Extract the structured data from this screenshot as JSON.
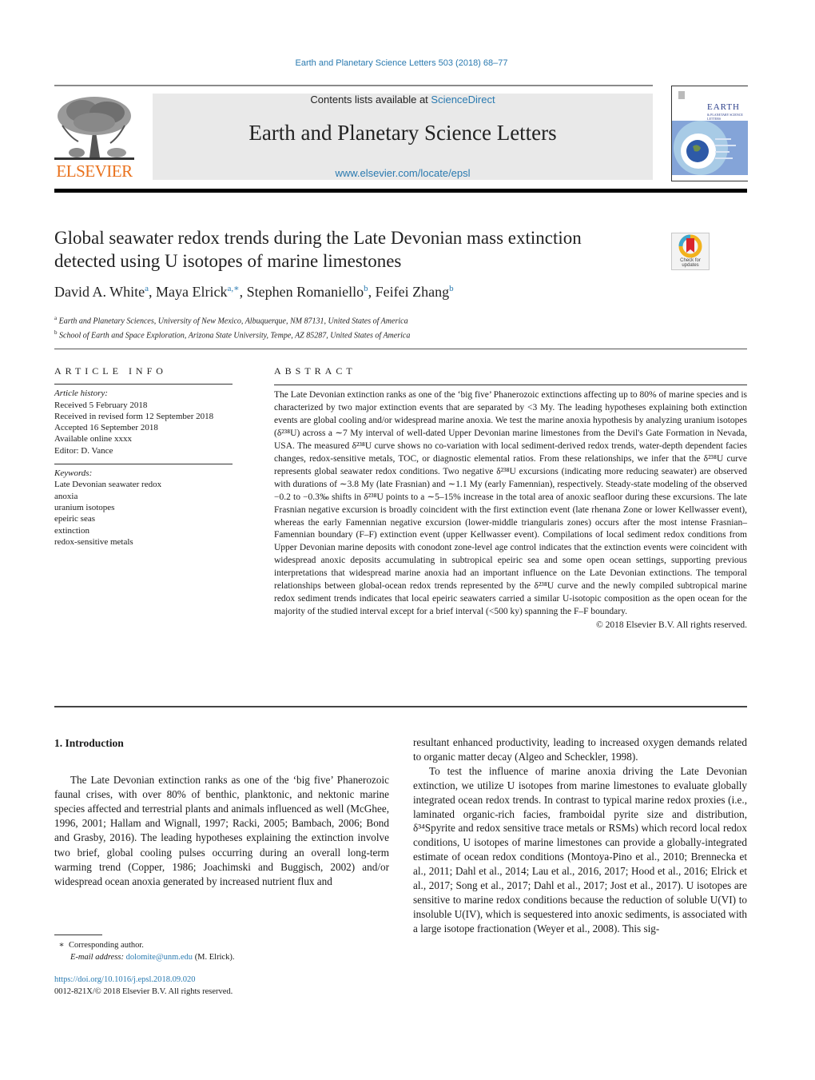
{
  "header": {
    "journal_reference": "Earth and Planetary Science Letters 503 (2018) 68–77",
    "contents_prefix": "Contents lists available at ",
    "contents_link": "ScienceDirect",
    "journal_title": "Earth and Planetary Science Letters",
    "journal_url": "www.elsevier.com/locate/epsl",
    "publisher_logo_text": "ELSEVIER",
    "cover_title": "EARTH",
    "cover_subtitle": "& PLANETARY SCIENCE LETTERS"
  },
  "article": {
    "title": "Global seawater redox trends during the Late Devonian mass extinction detected using U isotopes of marine limestones",
    "check_updates_label": "Check for updates",
    "authors": [
      {
        "name": "David A. White",
        "sup": "a"
      },
      {
        "name": "Maya Elrick",
        "sup": "a,∗"
      },
      {
        "name": "Stephen Romaniello",
        "sup": "b"
      },
      {
        "name": "Feifei Zhang",
        "sup": "b"
      }
    ],
    "affiliations": [
      {
        "sup": "a",
        "text": "Earth and Planetary Sciences, University of New Mexico, Albuquerque, NM 87131, United States of America"
      },
      {
        "sup": "b",
        "text": "School of Earth and Space Exploration, Arizona State University, Tempe, AZ 85287, United States of America"
      }
    ]
  },
  "article_info": {
    "heading": "ARTICLE INFO",
    "history_label": "Article history:",
    "history": [
      "Received 5 February 2018",
      "Received in revised form 12 September 2018",
      "Accepted 16 September 2018",
      "Available online xxxx",
      "Editor: D. Vance"
    ],
    "keywords_label": "Keywords:",
    "keywords": [
      "Late Devonian seawater redox",
      "anoxia",
      "uranium isotopes",
      "epeiric seas",
      "extinction",
      "redox-sensitive metals"
    ]
  },
  "abstract": {
    "heading": "ABSTRACT",
    "text": "The Late Devonian extinction ranks as one of the ‘big five’ Phanerozoic extinctions affecting up to 80% of marine species and is characterized by two major extinction events that are separated by <3 My. The leading hypotheses explaining both extinction events are global cooling and/or widespread marine anoxia. We test the marine anoxia hypothesis by analyzing uranium isotopes (δ²³⁸U) across a ∼7 My interval of well-dated Upper Devonian marine limestones from the Devil's Gate Formation in Nevada, USA. The measured δ²³⁸U curve shows no co-variation with local sediment-derived redox trends, water-depth dependent facies changes, redox-sensitive metals, TOC, or diagnostic elemental ratios. From these relationships, we infer that the δ²³⁸U curve represents global seawater redox conditions. Two negative δ²³⁸U excursions (indicating more reducing seawater) are observed with durations of ∼3.8 My (late Frasnian) and ∼1.1 My (early Famennian), respectively. Steady-state modeling of the observed −0.2 to −0.3‰ shifts in δ²³⁸U points to a ∼5–15% increase in the total area of anoxic seafloor during these excursions. The late Frasnian negative excursion is broadly coincident with the first extinction event (late rhenana Zone or lower Kellwasser event), whereas the early Famennian negative excursion (lower-middle triangularis zones) occurs after the most intense Frasnian–Famennian boundary (F–F) extinction event (upper Kellwasser event). Compilations of local sediment redox conditions from Upper Devonian marine deposits with conodont zone-level age control indicates that the extinction events were coincident with widespread anoxic deposits accumulating in subtropical epeiric sea and some open ocean settings, supporting previous interpretations that widespread marine anoxia had an important influence on the Late Devonian extinctions. The temporal relationships between global-ocean redox trends represented by the δ²³⁸U curve and the newly compiled subtropical marine redox sediment trends indicates that local epeiric seawaters carried a similar U-isotopic composition as the open ocean for the majority of the studied interval except for a brief interval (<500 ky) spanning the F–F boundary.",
    "copyright": "© 2018 Elsevier B.V. All rights reserved."
  },
  "body": {
    "section_heading": "1. Introduction",
    "left_paragraph": "The Late Devonian extinction ranks as one of the ‘big five’ Phanerozoic faunal crises, with over 80% of benthic, planktonic, and nektonic marine species affected and terrestrial plants and animals influenced as well (McGhee, 1996, 2001; Hallam and Wignall, 1997; Racki, 2005; Bambach, 2006; Bond and Grasby, 2016). The leading hypotheses explaining the extinction involve two brief, global cooling pulses occurring during an overall long-term warming trend (Copper, 1986; Joachimski and Buggisch, 2002) and/or widespread ocean anoxia generated by increased nutrient flux and",
    "right_paragraph_1": "resultant enhanced productivity, leading to increased oxygen demands related to organic matter decay (Algeo and Scheckler, 1998).",
    "right_paragraph_2": "To test the influence of marine anoxia driving the Late Devonian extinction, we utilize U isotopes from marine limestones to evaluate globally integrated ocean redox trends. In contrast to typical marine redox proxies (i.e., laminated organic-rich facies, framboidal pyrite size and distribution, δ³⁴Spyrite and redox sensitive trace metals or RSMs) which record local redox conditions, U isotopes of marine limestones can provide a globally-integrated estimate of ocean redox conditions (Montoya-Pino et al., 2010; Brennecka et al., 2011; Dahl et al., 2014; Lau et al., 2016, 2017; Hood et al., 2016; Elrick et al., 2017; Song et al., 2017; Dahl et al., 2017; Jost et al., 2017). U isotopes are sensitive to marine redox conditions because the reduction of soluble U(VI) to insoluble U(IV), which is sequestered into anoxic sediments, is associated with a large isotope fractionation (Weyer et al., 2008). This sig-"
  },
  "footnotes": {
    "corresponding_mark": "∗",
    "corresponding_label": "Corresponding author.",
    "email_label": "E-mail address:",
    "email": "dolomite@unm.edu",
    "email_suffix": "(M. Elrick).",
    "doi": "https://doi.org/10.1016/j.epsl.2018.09.020",
    "issn_copyright": "0012-821X/© 2018 Elsevier B.V. All rights reserved."
  },
  "colors": {
    "link": "#2a7ab0",
    "elsevier_orange": "#e9711c",
    "masthead_bg": "#e9e9e9"
  }
}
